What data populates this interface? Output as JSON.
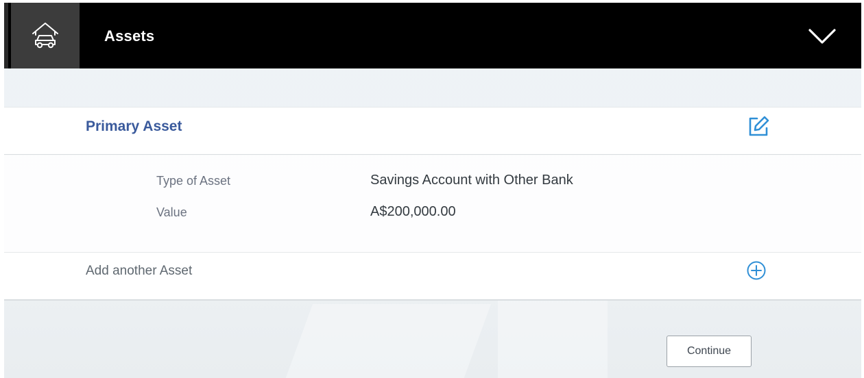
{
  "header": {
    "title": "Assets",
    "icon": "car-home-icon",
    "toggle_icon": "chevron-down-icon"
  },
  "primary_asset": {
    "title": "Primary Asset",
    "edit_icon": "edit-icon",
    "fields": [
      {
        "label": "Type of Asset",
        "value": "Savings Account with Other Bank"
      },
      {
        "label": "Value",
        "value": "A$200,000.00"
      }
    ]
  },
  "add_asset": {
    "label": "Add another Asset",
    "icon": "add-circle-icon"
  },
  "actions": {
    "continue_label": "Continue"
  },
  "colors": {
    "header_bg": "#000000",
    "accent_blue": "#3a5a9c",
    "icon_blue": "#2f8fd6"
  }
}
